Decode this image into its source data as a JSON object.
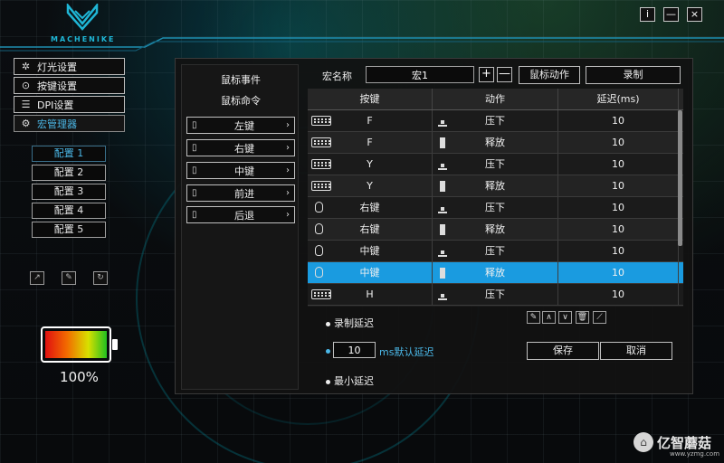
{
  "app": {
    "logo_text": "MACHENIKE"
  },
  "window_controls": {
    "info": "i",
    "minimize": "—",
    "close": "×"
  },
  "nav": {
    "items": [
      {
        "label": "灯光设置",
        "icon": "sun-icon"
      },
      {
        "label": "按键设置",
        "icon": "mouse-icon"
      },
      {
        "label": "DPI设置",
        "icon": "sliders-icon"
      },
      {
        "label": "宏管理器",
        "icon": "gear-icon"
      }
    ],
    "active_index": 3
  },
  "profiles": {
    "items": [
      "配置 1",
      "配置 2",
      "配置 3",
      "配置 4",
      "配置 5"
    ],
    "active_index": 0
  },
  "battery": {
    "level": 1.0,
    "text": "100%"
  },
  "events_panel": {
    "title": "鼠标事件",
    "subtitle": "鼠标命令",
    "buttons": [
      "左键",
      "右键",
      "中键",
      "前进",
      "后退"
    ]
  },
  "macro": {
    "name_label": "宏名称",
    "name_value": "宏1",
    "add": "+",
    "remove": "—",
    "mouse_action_label": "鼠标动作",
    "record_label": "录制"
  },
  "table": {
    "headers": [
      "按键",
      "动作",
      "延迟(ms)"
    ],
    "rows": [
      {
        "device": "keyboard",
        "key": "F",
        "action": "压下",
        "action_type": "down",
        "delay": "10"
      },
      {
        "device": "keyboard",
        "key": "F",
        "action": "释放",
        "action_type": "up",
        "delay": "10"
      },
      {
        "device": "keyboard",
        "key": "Y",
        "action": "压下",
        "action_type": "down",
        "delay": "10"
      },
      {
        "device": "keyboard",
        "key": "Y",
        "action": "释放",
        "action_type": "up",
        "delay": "10"
      },
      {
        "device": "mouse",
        "key": "右键",
        "action": "压下",
        "action_type": "down",
        "delay": "10"
      },
      {
        "device": "mouse",
        "key": "右键",
        "action": "释放",
        "action_type": "up",
        "delay": "10"
      },
      {
        "device": "mouse",
        "key": "中键",
        "action": "压下",
        "action_type": "down",
        "delay": "10"
      },
      {
        "device": "mouse",
        "key": "中键",
        "action": "释放",
        "action_type": "up",
        "delay": "10"
      },
      {
        "device": "keyboard",
        "key": "H",
        "action": "压下",
        "action_type": "down",
        "delay": "10"
      }
    ],
    "selected_index": 7
  },
  "options": {
    "record_delay": "录制延迟",
    "default_delay_value": "10",
    "default_delay_label": "ms默认延迟",
    "min_delay": "最小延迟"
  },
  "buttons": {
    "save": "保存",
    "cancel": "取消"
  },
  "edit_tools": [
    "pencil-icon",
    "arrow-up-icon",
    "arrow-down-icon",
    "trash-icon",
    "broom-icon"
  ],
  "watermark": {
    "text": "亿智蘑菇",
    "url": "www.yzmg.com"
  },
  "colors": {
    "accent": "#1a9be0",
    "logo": "#1fb6d6"
  }
}
